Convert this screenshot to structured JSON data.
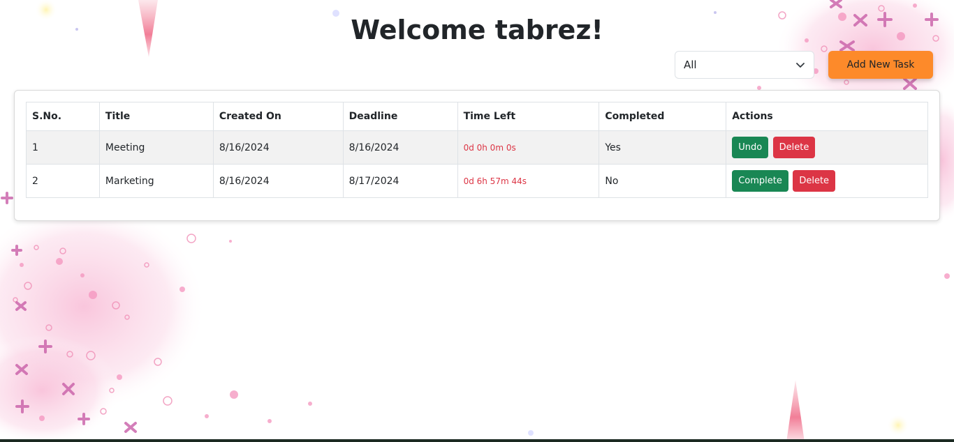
{
  "header": {
    "title": "Welcome tabrez!"
  },
  "controls": {
    "filter_value": "All",
    "add_button_label": "Add New Task"
  },
  "table": {
    "columns": [
      "S.No.",
      "Title",
      "Created On",
      "Deadline",
      "Time Left",
      "Completed",
      "Actions"
    ],
    "rows": [
      {
        "sno": "1",
        "title": "Meeting",
        "created_on": "8/16/2024",
        "deadline": "8/16/2024",
        "time_left": "0d 0h 0m 0s",
        "completed": "Yes",
        "primary_action": "Undo",
        "secondary_action": "Delete"
      },
      {
        "sno": "2",
        "title": "Marketing",
        "created_on": "8/16/2024",
        "deadline": "8/17/2024",
        "time_left": "0d 6h 57m 44s",
        "completed": "No",
        "primary_action": "Complete",
        "secondary_action": "Delete"
      }
    ]
  },
  "colors": {
    "accent_orange": "#fd8a2a",
    "success_green": "#198754",
    "danger_red": "#dc3545",
    "decoration_pink": "#f4a6c7"
  }
}
